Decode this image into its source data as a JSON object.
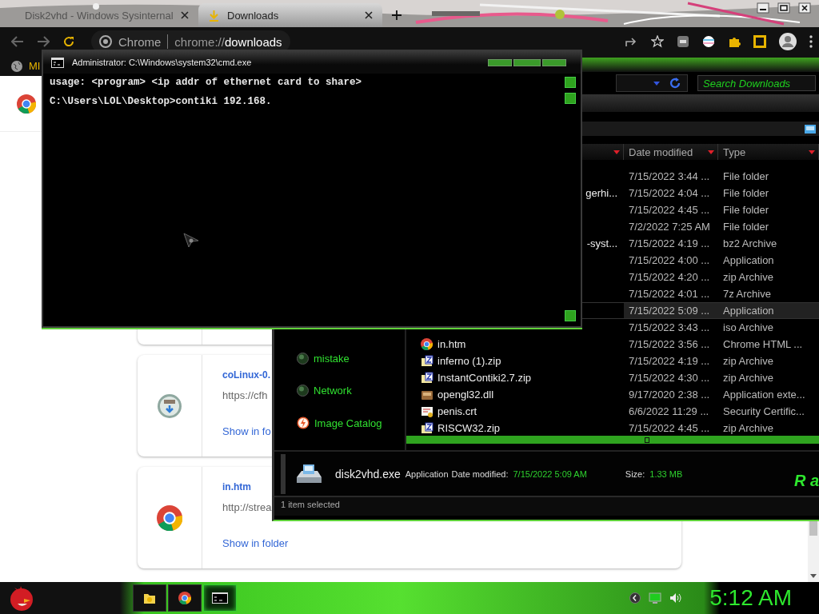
{
  "browser": {
    "tabs": [
      {
        "title": "Disk2vhd - Windows Sysinternal",
        "kind": "windows",
        "selected": false
      },
      {
        "title": "Downloads",
        "kind": "download",
        "selected": true
      }
    ],
    "omnibox": {
      "site": "Chrome",
      "url": "chrome://**downloads**"
    },
    "bookmark": "MI"
  },
  "downloads": [
    {
      "title": "coLinux-0.",
      "url": "https://cfh",
      "action": "Show in fo",
      "kind": "installer"
    },
    {
      "title": "in.htm",
      "url": "http://strea",
      "action": "Show in folder",
      "kind": "chrome"
    }
  ],
  "cmd": {
    "title": "Administrator: C:\\Windows\\system32\\cmd.exe",
    "lines": [
      "usage: <program> <ip addr of ethernet card to share>",
      "C:\\Users\\LOL\\Desktop>contiki 192.168."
    ]
  },
  "explorer": {
    "search": {
      "placeholder": "Search Downloads"
    },
    "columns": [
      "Date modified",
      "Type"
    ],
    "rows": [
      {
        "date": "7/15/2022 3:44 ...",
        "type": "File folder",
        "selected": false
      },
      {
        "name": "gerhi...",
        "date": "7/15/2022 4:04 ...",
        "type": "File folder",
        "selected": false
      },
      {
        "date": "7/15/2022 4:45 ...",
        "type": "File folder",
        "selected": false
      },
      {
        "date": "7/2/2022 7:25 AM",
        "type": "File folder",
        "selected": false
      },
      {
        "name": "-syst...",
        "date": "7/15/2022 4:19 ...",
        "type": "bz2 Archive",
        "selected": false
      },
      {
        "date": "7/15/2022 4:00 ...",
        "type": "Application",
        "selected": false
      },
      {
        "date": "7/15/2022 4:20 ...",
        "type": "zip Archive",
        "selected": false
      },
      {
        "date": "7/15/2022 4:01 ...",
        "type": "7z Archive",
        "selected": false
      },
      {
        "date": "7/15/2022 5:09 ...",
        "type": "Application",
        "selected": true
      },
      {
        "date": "7/15/2022 3:43 ...",
        "type": "iso Archive",
        "selected": false
      },
      {
        "name": "in.htm",
        "kind": "chrome",
        "date": "7/15/2022 3:56 ...",
        "type": "Chrome HTML ...",
        "selected": false
      },
      {
        "name": "inferno (1).zip",
        "kind": "zip",
        "date": "7/15/2022 4:19 ...",
        "type": "zip Archive",
        "selected": false
      },
      {
        "name": "InstantContiki2.7.zip",
        "kind": "zip",
        "date": "7/15/2022 4:30 ...",
        "type": "zip Archive",
        "selected": false
      },
      {
        "name": "opengl32.dll",
        "kind": "dll",
        "date": "9/17/2020 2:38 ...",
        "type": "Application exte...",
        "selected": false
      },
      {
        "name": "penis.crt",
        "kind": "cert",
        "date": "6/6/2022 11:29 ...",
        "type": "Security Certific...",
        "selected": false
      },
      {
        "name": "RISCW32.zip",
        "kind": "zip",
        "date": "7/15/2022 4:45 ...",
        "type": "zip Archive",
        "selected": false
      }
    ],
    "sidebar": [
      {
        "label": "mistake",
        "kind": "orb"
      },
      {
        "label": "Network",
        "kind": "orb"
      },
      {
        "label": "Image Catalog",
        "kind": "bolt"
      }
    ],
    "details": {
      "name": "disk2vhd.exe",
      "type": "Application",
      "date_label": "Date modified:",
      "date": "7/15/2022 5:09 AM",
      "size_label": "Size:",
      "size": "1.33 MB",
      "logo": "R a"
    },
    "status": "1 item selected"
  },
  "taskbar": {
    "apps": [
      {
        "kind": "folder",
        "selected": false
      },
      {
        "kind": "chrome",
        "selected": false
      },
      {
        "kind": "terminal",
        "selected": true
      }
    ],
    "clock": "5:12 AM"
  }
}
